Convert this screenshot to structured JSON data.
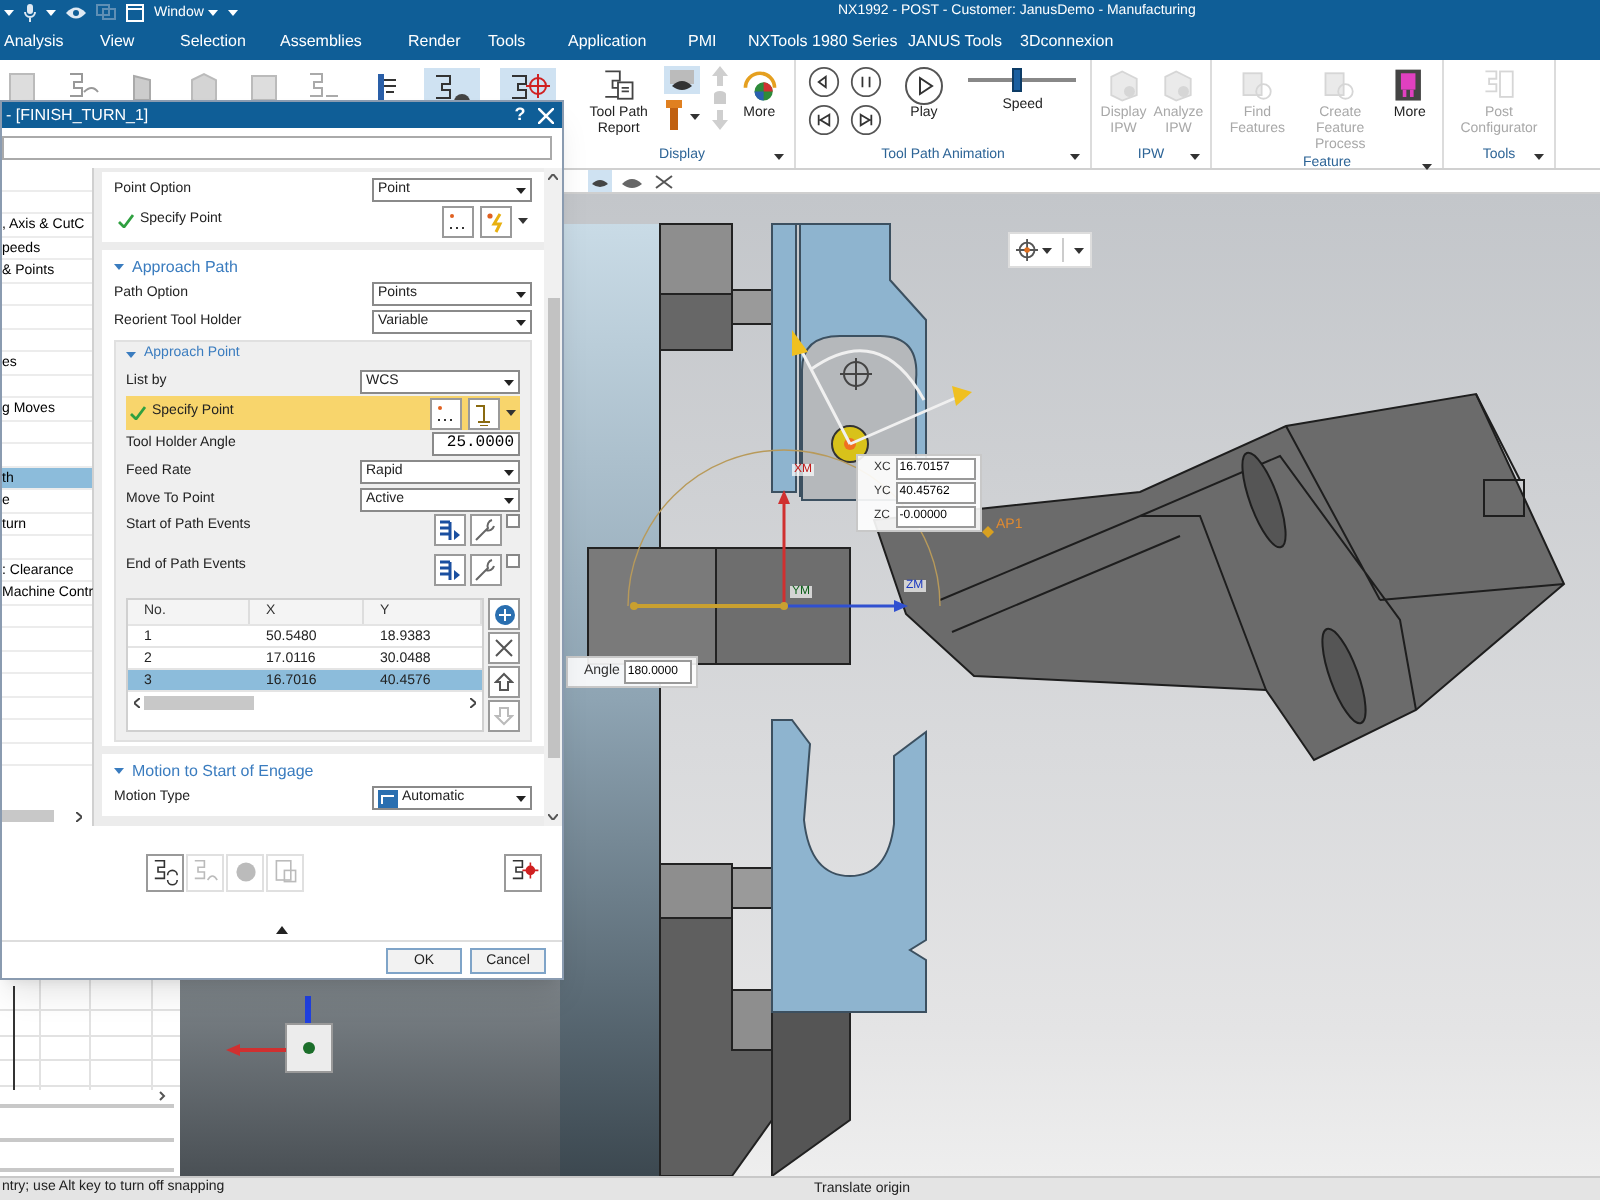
{
  "window": {
    "title": "NX1992 - POST - Customer: JanusDemo - Manufacturing",
    "quick_access_menu": "Window"
  },
  "menu": [
    "Analysis",
    "View",
    "Selection",
    "Assemblies",
    "Render",
    "Tools",
    "Application",
    "PMI",
    "NXTools 1980 Series",
    "JANUS Tools",
    "3Dconnexion"
  ],
  "ribbon": {
    "groups": [
      {
        "title": "Display",
        "items": [
          {
            "kind": "large",
            "label": "Tool Path Report",
            "disabled": false
          },
          {
            "kind": "stack"
          },
          {
            "kind": "large",
            "label": "More",
            "disabled": false
          }
        ]
      },
      {
        "title": "Tool Path Animation",
        "items": [
          {
            "kind": "play",
            "label": "Play",
            "disabled": false
          },
          {
            "kind": "slider",
            "label": "Speed",
            "level": 0.45
          }
        ]
      },
      {
        "title": "IPW",
        "items": [
          {
            "kind": "large",
            "label": "Display IPW",
            "disabled": true
          },
          {
            "kind": "large",
            "label": "Analyze IPW",
            "disabled": true
          }
        ]
      },
      {
        "title": "Feature",
        "items": [
          {
            "kind": "large",
            "label": "Find Features",
            "disabled": true
          },
          {
            "kind": "large",
            "label": "Create Feature Process",
            "disabled": true
          },
          {
            "kind": "large",
            "label": "More",
            "disabled": false
          }
        ]
      },
      {
        "title": "Tools",
        "items": [
          {
            "kind": "large",
            "label": "Post Configurator",
            "disabled": true
          }
        ]
      }
    ]
  },
  "dialog": {
    "title": "- [FINISH_TURN_1]",
    "help": "?",
    "nav_items": [
      {
        "selected": false
      },
      {
        "selected": false
      },
      {
        "label": ", Axis & CutC",
        "selected": false
      },
      {
        "label": "peeds",
        "selected": false
      },
      {
        "label": "& Points",
        "selected": false
      },
      {
        "selected": false
      },
      {
        "selected": false
      },
      {
        "selected": false
      },
      {
        "label": "es",
        "selected": false
      },
      {
        "selected": false
      },
      {
        "label": "g Moves",
        "selected": false
      },
      {
        "selected": false
      },
      {
        "selected": false
      },
      {
        "label": "th",
        "selected": true
      },
      {
        "label": "e",
        "selected": false
      },
      {
        "label": "turn",
        "selected": false
      },
      {
        "selected": false
      },
      {
        "label": ": Clearance",
        "selected": false
      },
      {
        "label": "Machine Contr",
        "selected": false
      },
      {
        "selected": false
      },
      {
        "selected": false
      },
      {
        "selected": false
      },
      {
        "selected": false
      },
      {
        "selected": false
      },
      {
        "selected": false
      },
      {
        "selected": false
      }
    ],
    "sections": [
      {
        "rows": [
          {
            "kind": "dropdown",
            "label": "Point Option",
            "value": "Point"
          },
          {
            "kind": "point",
            "label": "Specify Point",
            "specified": true,
            "highlighted": false
          }
        ]
      },
      {
        "title": "Approach Path",
        "expanded": true,
        "rows": [
          {
            "kind": "dropdown",
            "label": "Path Option",
            "value": "Points"
          },
          {
            "kind": "dropdown",
            "label": "Reorient Tool Holder",
            "value": "Variable"
          },
          {
            "kind": "group",
            "title": "Approach Point",
            "expanded": true,
            "rows": [
              {
                "kind": "dropdown",
                "label": "List by",
                "value": "WCS"
              },
              {
                "kind": "point",
                "label": "Specify Point",
                "specified": true,
                "highlighted": true
              },
              {
                "kind": "input",
                "label": "Tool Holder Angle",
                "value": "25.0000"
              },
              {
                "kind": "dropdown",
                "label": "Feed Rate",
                "value": "Rapid"
              },
              {
                "kind": "dropdown",
                "label": "Move To Point",
                "value": "Active"
              },
              {
                "kind": "events",
                "label": "Start of Path Events",
                "checked": false
              },
              {
                "kind": "events",
                "label": "End of Path Events",
                "checked": false
              },
              {
                "kind": "table",
                "columns": [
                  "No.",
                  "X",
                  "Y"
                ],
                "rows": [
                  {
                    "cells": [
                      "1",
                      "50.5480",
                      "18.9383"
                    ],
                    "selected": false
                  },
                  {
                    "cells": [
                      "2",
                      "17.0116",
                      "30.0488"
                    ],
                    "selected": false
                  },
                  {
                    "cells": [
                      "3",
                      "16.7016",
                      "40.4576"
                    ],
                    "selected": true
                  }
                ]
              }
            ]
          }
        ]
      },
      {
        "title": "Motion to Start of Engage",
        "expanded": true,
        "rows": [
          {
            "kind": "icon_dropdown",
            "label": "Motion Type",
            "value": "Automatic"
          }
        ]
      }
    ],
    "buttons": [
      "OK",
      "Cancel"
    ]
  },
  "viewport": {
    "handle_fields": [
      {
        "label": "XC",
        "value": "16.70157"
      },
      {
        "label": "YC",
        "value": "40.45762"
      },
      {
        "label": "ZC",
        "value": "-0.00000"
      }
    ],
    "angle": {
      "label": "Angle",
      "value": "180.0000"
    },
    "axis_labels": [
      "XM",
      "YM",
      "ZM"
    ],
    "point_label": "AP1"
  },
  "status_bar": {
    "prompt": "ntry; use Alt key to turn off snapping",
    "action": "Translate origin"
  }
}
